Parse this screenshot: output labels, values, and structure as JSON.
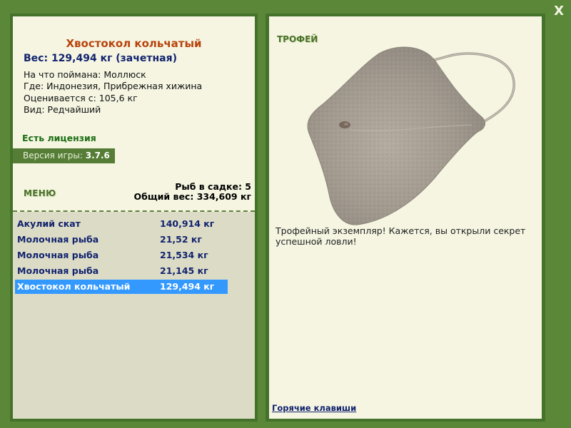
{
  "window": {
    "close_label": "X"
  },
  "fish": {
    "title": "Хвостокол кольчатый",
    "weight_line": "Вес: 129,494 кг (зачетная)",
    "info": [
      "На что поймана: Моллюск",
      "Где: Индонезия, Прибрежная хижина",
      "Оценивается с: 105,6 кг",
      "Вид: Редчайший"
    ]
  },
  "license_text": "Есть лицензия",
  "version": {
    "label": "Версия игры: ",
    "value": "3.7.6"
  },
  "menu_label": "МЕНЮ",
  "cage": {
    "count_line": "Рыб в садке: 5",
    "total_line": "Общий вес: 334,609 кг"
  },
  "catch_list": [
    {
      "name": "Акулий скат",
      "weight": "140,914 кг"
    },
    {
      "name": "Молочная рыба",
      "weight": "21,52 кг"
    },
    {
      "name": "Молочная рыба",
      "weight": "21,534 кг"
    },
    {
      "name": "Молочная рыба",
      "weight": "21,145 кг"
    },
    {
      "name": "Хвостокол кольчатый",
      "weight": "129,494 кг",
      "selected": true
    }
  ],
  "trophy": {
    "label": "ТРОФЕЙ",
    "text": "Трофейный экземпляр! Кажется, вы открыли секрет успешной ловли!"
  },
  "hotkeys_label": "Горячие клавиши",
  "colors": {
    "frame": "#5b8838",
    "panel": "#f5f5e2",
    "title": "#b8440c",
    "selected_row": "#3399ff"
  }
}
